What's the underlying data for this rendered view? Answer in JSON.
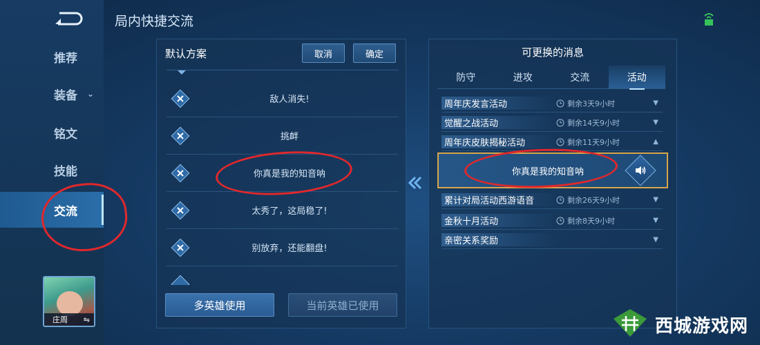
{
  "header": {
    "title": "局内快捷交流"
  },
  "sidebar": {
    "items": [
      {
        "label": "推荐",
        "has_chevron": false,
        "active": false
      },
      {
        "label": "装备",
        "has_chevron": true,
        "active": false
      },
      {
        "label": "铭文",
        "has_chevron": false,
        "active": false
      },
      {
        "label": "技能",
        "has_chevron": false,
        "active": false
      },
      {
        "label": "交流",
        "has_chevron": false,
        "active": true
      }
    ],
    "hero": {
      "name": "庄周",
      "swap_icon": "⇋"
    }
  },
  "left_panel": {
    "title": "默认方案",
    "cancel_label": "取消",
    "confirm_label": "确定",
    "messages": [
      "敌人消失!",
      "挑衅",
      "你真是我的知音呐",
      "太秀了，这局稳了!",
      "别放弃，还能翻盘!"
    ],
    "multi_hero_label": "多英雄使用",
    "current_hero_label": "当前英雄已使用"
  },
  "right_panel": {
    "title": "可更换的消息",
    "tabs": [
      "防守",
      "进攻",
      "交流",
      "活动"
    ],
    "active_tab": 3,
    "categories": [
      {
        "name": "周年庆发言活动",
        "time": "剩余3天9小时",
        "expanded": false
      },
      {
        "name": "觉醒之战活动",
        "time": "剩余14天9小时",
        "expanded": false
      },
      {
        "name": "周年庆皮肤揭秘活动",
        "time": "剩余11天9小时",
        "expanded": true
      },
      {
        "name": "累计对局活动西游语音",
        "time": "剩余26天9小时",
        "expanded": false
      },
      {
        "name": "金秋十月活动",
        "time": "剩余8天9小时",
        "expanded": false
      },
      {
        "name": "亲密关系奖励",
        "time": "",
        "expanded": false
      }
    ],
    "expanded_message": "你真是我的知音呐"
  },
  "watermark": {
    "text": "西城游戏网"
  },
  "colors": {
    "accent": "#bfe7ff",
    "highlight_border": "#d9a64a",
    "annotation": "#e0282c"
  },
  "icons": {
    "back": "back-arrow-icon",
    "delete": "close-icon",
    "clock": "clock-icon",
    "speaker": "speaker-icon",
    "move_left": "double-chevron-left-icon",
    "wifi": "wifi-icon"
  }
}
